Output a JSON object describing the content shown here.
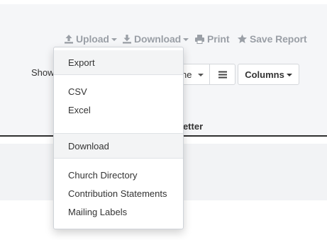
{
  "toolbar": {
    "upload_label": "Upload",
    "download_label": "Download",
    "print_label": "Print",
    "save_report_label": "Save Report"
  },
  "controls": {
    "show_label": "Show",
    "select_value": "ne",
    "columns_label": "Columns"
  },
  "table": {
    "visible_column_header": "wsletter"
  },
  "dropdown": {
    "export_section": {
      "title": "Export",
      "items": [
        "CSV",
        "Excel"
      ]
    },
    "download_section": {
      "title": "Download",
      "items": [
        "Church Directory",
        "Contribution Statements",
        "Mailing Labels"
      ]
    }
  },
  "colors": {
    "toolbar_text": "#9a9fa6",
    "header_bg": "#f5f6f8",
    "section_bg": "#f3f4f5",
    "rule": "#2f2f2f"
  }
}
